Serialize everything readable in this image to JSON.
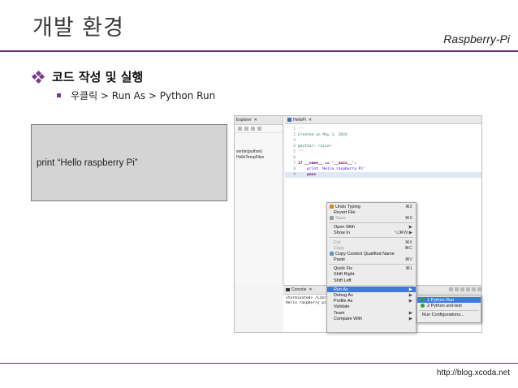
{
  "slide": {
    "title": "개발 환경",
    "brand": "Raspberry-Pi",
    "footer_url": "http://blog.xcoda.net",
    "accent_color": "#6d2e7a"
  },
  "bullets": {
    "level1": "코드 작성 및 실행",
    "level2": "우클릭 > Run As > Python Run"
  },
  "code_box": {
    "text": "print “Hello raspberry Pi”"
  },
  "ide": {
    "explorer_tab": "Explorer",
    "tree": [
      "serbin(python)",
      "HelloTempFiles"
    ],
    "editor_tab": "HelloPi",
    "code": [
      {
        "n": "1",
        "t": "'''"
      },
      {
        "n": "2",
        "t": "Created on May 3, 2016"
      },
      {
        "n": "3",
        "t": ""
      },
      {
        "n": "4",
        "t": "@author: rainer"
      },
      {
        "n": "5",
        "t": "'''"
      },
      {
        "n": "6",
        "t": ""
      },
      {
        "n": "7",
        "t": "if __name__ == '__main__':"
      },
      {
        "n": "8",
        "t": "    print 'Hello raspberry Pi'"
      },
      {
        "n": "9",
        "t": "    pass"
      }
    ],
    "console_tab": "Console",
    "console_lines": [
      "<terminated> /Library/...",
      "Hello raspberry pi"
    ]
  },
  "context_menu": {
    "groups": [
      [
        {
          "label": "Undo Typing",
          "shortcut": "⌘Z",
          "icon": "undo-icon",
          "disabled": false
        },
        {
          "label": "Revert File",
          "shortcut": "",
          "icon": "",
          "disabled": false
        },
        {
          "label": "Save",
          "shortcut": "⌘S",
          "icon": "save-icon",
          "disabled": true
        }
      ],
      [
        {
          "label": "Open With",
          "shortcut": "▶",
          "icon": "",
          "disabled": false
        },
        {
          "label": "Show In",
          "shortcut": "⌥⌘W  ▶",
          "icon": "",
          "disabled": false
        }
      ],
      [
        {
          "label": "Cut",
          "shortcut": "⌘X",
          "icon": "",
          "disabled": true
        },
        {
          "label": "Copy",
          "shortcut": "⌘C",
          "icon": "",
          "disabled": true
        },
        {
          "label": "Copy Context Qualified Name",
          "shortcut": "",
          "icon": "copy-icon",
          "disabled": false
        },
        {
          "label": "Paste",
          "shortcut": "⌘V",
          "icon": "",
          "disabled": false
        }
      ],
      [
        {
          "label": "Quick Fix",
          "shortcut": "⌘1",
          "icon": "",
          "disabled": false
        },
        {
          "label": "Shift Right",
          "shortcut": "",
          "icon": "",
          "disabled": false
        },
        {
          "label": "Shift Left",
          "shortcut": "",
          "icon": "",
          "disabled": false
        }
      ],
      [
        {
          "label": "Run As",
          "shortcut": "▶",
          "icon": "",
          "disabled": false,
          "selected": true
        },
        {
          "label": "Debug As",
          "shortcut": "▶",
          "icon": "",
          "disabled": false
        },
        {
          "label": "Profile As",
          "shortcut": "▶",
          "icon": "",
          "disabled": false
        },
        {
          "label": "Validate",
          "shortcut": "",
          "icon": "",
          "disabled": false
        },
        {
          "label": "Team",
          "shortcut": "▶",
          "icon": "",
          "disabled": false
        },
        {
          "label": "Compare With",
          "shortcut": "▶",
          "icon": "",
          "disabled": false
        }
      ]
    ]
  },
  "submenu": {
    "items": [
      {
        "label": "1 Python Run",
        "selected": true
      },
      {
        "label": "2 Python unit-test",
        "selected": false
      }
    ],
    "footer": "Run Configurations..."
  }
}
